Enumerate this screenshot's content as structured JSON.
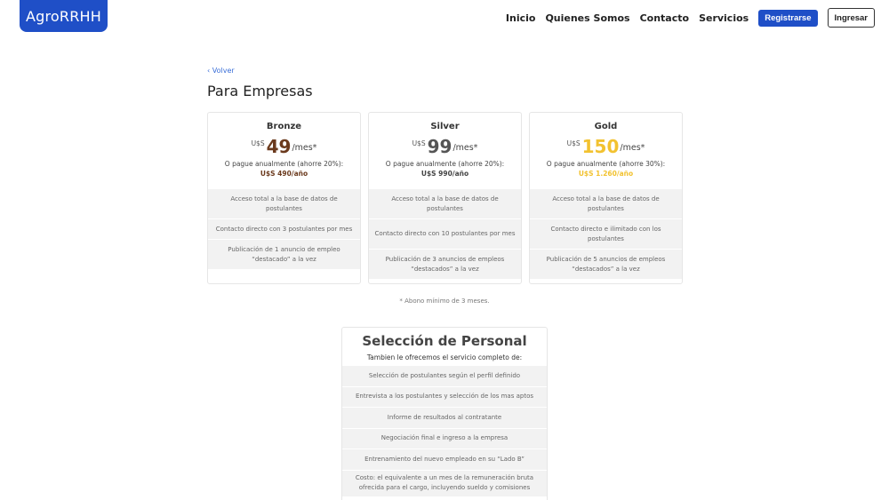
{
  "brand": {
    "logo_text": "AgroRRHH",
    "brand_color": "#1f4fc7"
  },
  "nav": {
    "links": [
      "Inicio",
      "Quienes Somos",
      "Contacto",
      "Servicios"
    ],
    "register_label": "Registrarse",
    "login_label": "Ingresar"
  },
  "back_label": "‹ Volver",
  "page_title": "Para Empresas",
  "plans": [
    {
      "name": "Bronze",
      "currency": "U$S",
      "amount": "49",
      "per": "/mes*",
      "annual_text": "O pague anualmente (ahorre 20%):",
      "annual_price": "U$S 490/año",
      "color": "#6b3a1d",
      "features": [
        "Acceso total a la base de datos de postulantes",
        "Contacto directo con 3 postulantes por mes",
        "Publicación de 1 anuncio de empleo “destacado” a la vez"
      ]
    },
    {
      "name": "Silver",
      "currency": "U$S",
      "amount": "99",
      "per": "/mes*",
      "annual_text": "O pague anualmente (ahorre 20%):",
      "annual_price": "U$S 990/año",
      "color": "#555555",
      "features": [
        "Acceso total a la base de datos de postulantes",
        "Contacto directo con 10 postulantes por mes",
        "Publicación de 3 anuncios de empleos “destacados” a la vez"
      ]
    },
    {
      "name": "Gold",
      "currency": "U$S",
      "amount": "150",
      "per": "/mes*",
      "annual_text": "O pague anualmente (ahorre 30%):",
      "annual_price": "U$S 1.260/año",
      "color": "#f2c230",
      "features": [
        "Acceso total a la base de datos de postulantes",
        "Contacto directo e ilimitado con los postulantes",
        "Publicación de 5 anuncios de empleos “destacados” a la vez"
      ]
    }
  ],
  "footnote": "* Abono mínimo de 3 meses.",
  "selection": {
    "title": "Selección de Personal",
    "subtitle": "Tambien le ofrecemos el servicio completo de:",
    "items": [
      "Selección de postulantes según el perfil definido",
      "Entrevista a los postulantes y selección de los mas aptos",
      "Informe de resultados al contratante",
      "Negociación final e ingreso a la empresa",
      "Entrenamiento del nuevo empleado en su “Lado B”",
      "Costo: el equivalente a un mes de la remuneración bruta ofrecida para el cargo, incluyendo sueldo y comisiones"
    ]
  }
}
